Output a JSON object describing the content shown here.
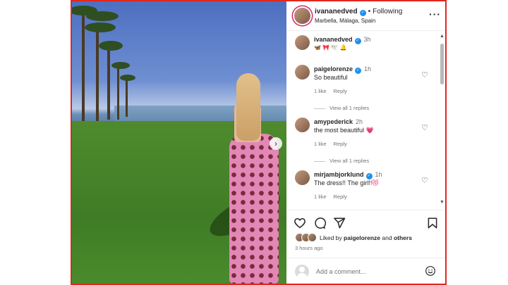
{
  "post": {
    "username": "ivananedved",
    "following": "Following",
    "separator": "•",
    "location": "Marbella, Málaga, Spain"
  },
  "caption": {
    "username": "ivananedved",
    "time": "3h",
    "text": "🦋 🎀 🕊️ 🔔"
  },
  "comments": [
    {
      "username": "paigelorenze",
      "time": "1h",
      "text": "So beautiful",
      "emoji": "",
      "likes": "1 like",
      "reply": "Reply",
      "replies": "View all 1 replies",
      "verified": true
    },
    {
      "username": "amypederick",
      "time": "2h",
      "text": "the most beautiful",
      "emoji": "💗",
      "likes": "1 like",
      "reply": "Reply",
      "replies": "View all 1 replies",
      "verified": false
    },
    {
      "username": "mirjambjorklund",
      "time": "1h",
      "text": "The dress!! The girl!!",
      "emoji": "😻",
      "likes": "1 like",
      "reply": "Reply",
      "replies": "",
      "verified": true
    }
  ],
  "likes": {
    "prefix": "Liked by",
    "user": "paigelorenze",
    "middle": "and",
    "others": "others"
  },
  "timestamp": "3 hours ago",
  "add_comment": {
    "placeholder": "Add a comment..."
  },
  "icons": {
    "like": "heart-icon",
    "comment": "comment-icon",
    "share": "share-icon",
    "save": "bookmark-icon",
    "more": "more-options-icon",
    "next": "chevron-right-icon",
    "emoji": "smiley-icon"
  },
  "colors": {
    "accent_border": "#e0281e",
    "verified": "#1f8fef",
    "heart": "#e8457e"
  }
}
